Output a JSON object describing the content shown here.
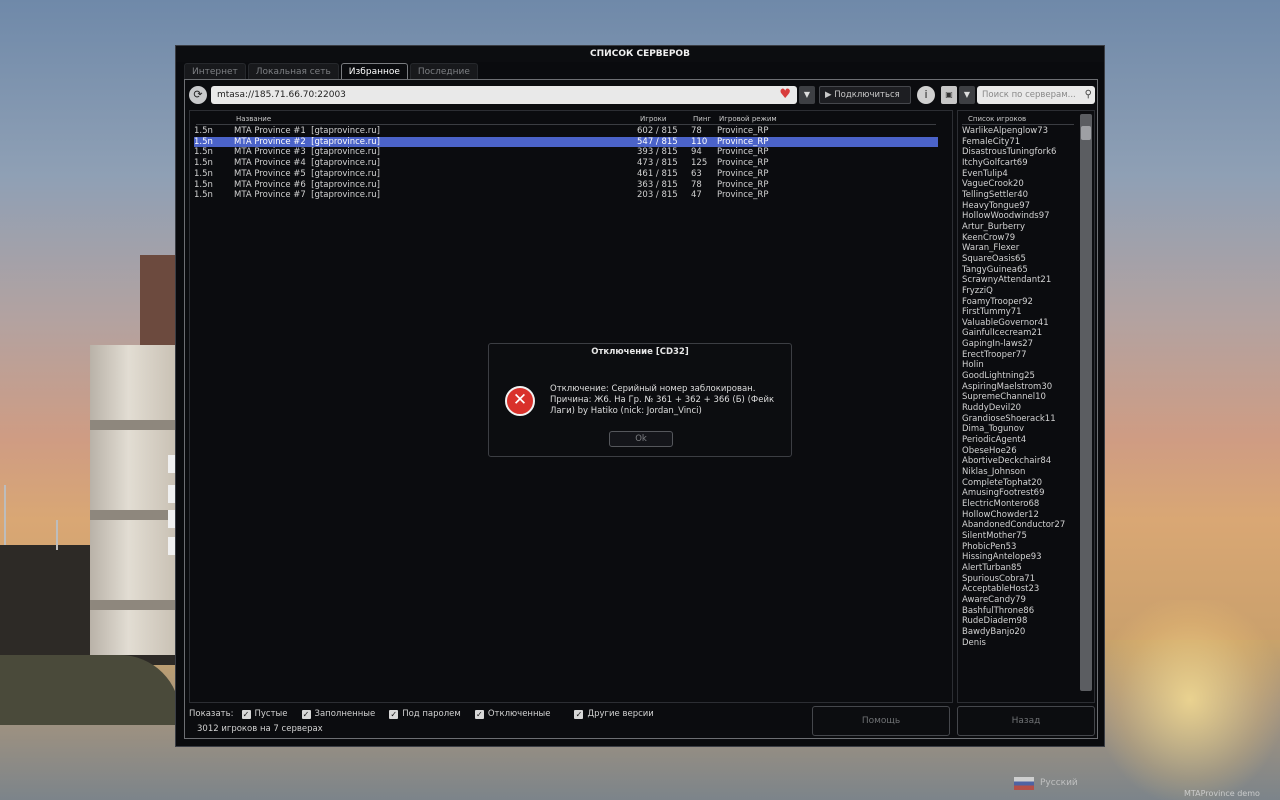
{
  "window": {
    "title": "СПИСОК СЕРВЕРОВ"
  },
  "tabs": [
    {
      "label": "Интернет",
      "active": false
    },
    {
      "label": "Локальная сеть",
      "active": false
    },
    {
      "label": "Избранное",
      "active": true
    },
    {
      "label": "Последние",
      "active": false
    }
  ],
  "toolbar": {
    "address": "mtasa://185.71.66.70:22003",
    "connect_label": "Подключиться",
    "search_placeholder": "Поиск по серверам..."
  },
  "server_list": {
    "columns": {
      "name": "Название",
      "players": "Игроки",
      "ping": "Пинг",
      "gamemode": "Игровой режим"
    },
    "rows": [
      {
        "version": "1.5n",
        "name": "MTA Province #1  [gtaprovince.ru]",
        "players": "602 / 815",
        "ping": "78",
        "gamemode": "Province_RP",
        "selected": false
      },
      {
        "version": "1.5n",
        "name": "MTA Province #2  [gtaprovince.ru]",
        "players": "547 / 815",
        "ping": "110",
        "gamemode": "Province_RP",
        "selected": true
      },
      {
        "version": "1.5n",
        "name": "MTA Province #3  [gtaprovince.ru]",
        "players": "393 / 815",
        "ping": "94",
        "gamemode": "Province_RP",
        "selected": false
      },
      {
        "version": "1.5n",
        "name": "MTA Province #4  [gtaprovince.ru]",
        "players": "473 / 815",
        "ping": "125",
        "gamemode": "Province_RP",
        "selected": false
      },
      {
        "version": "1.5n",
        "name": "MTA Province #5  [gtaprovince.ru]",
        "players": "461 / 815",
        "ping": "63",
        "gamemode": "Province_RP",
        "selected": false
      },
      {
        "version": "1.5n",
        "name": "MTA Province #6  [gtaprovince.ru]",
        "players": "363 / 815",
        "ping": "78",
        "gamemode": "Province_RP",
        "selected": false
      },
      {
        "version": "1.5n",
        "name": "MTA Province #7  [gtaprovince.ru]",
        "players": "203 / 815",
        "ping": "47",
        "gamemode": "Province_RP",
        "selected": false
      }
    ]
  },
  "players_panel": {
    "header": "Список игроков",
    "players": [
      "WarlikeAlpenglow73",
      "FemaleCity71",
      "DisastrousTuningfork6",
      "ItchyGolfcart69",
      "EvenTulip4",
      "VagueCrook20",
      "TellingSettler40",
      "HeavyTongue97",
      "HollowWoodwinds97",
      "Artur_Burberry",
      "KeenCrow79",
      "Waran_Flexer",
      "SquareOasis65",
      "TangyGuinea65",
      "ScrawnyAttendant21",
      "FryzziQ",
      "FoamyTrooper92",
      "FirstTummy71",
      "ValuableGovernor41",
      "GainfulIcecream21",
      "GapingIn-laws27",
      "ErectTrooper77",
      "Holin",
      "GoodLightning25",
      "AspiringMaelstrom30",
      "SupremeChannel10",
      "RuddyDevil20",
      "GrandioseShoerack11",
      "Dima_Togunov",
      "PeriodicAgent4",
      "ObeseHoe26",
      "AbortiveDeckchair84",
      "Niklas_Johnson",
      "CompleteTophat20",
      "AmusingFootrest69",
      "ElectricMontero68",
      "HollowChowder12",
      "AbandonedConductor27",
      "SilentMother75",
      "PhobicPen53",
      "HissingAntelope93",
      "AlertTurban85",
      "SpuriousCobra71",
      "AcceptableHost23",
      "AwareCandy79",
      "BashfulThrone86",
      "RudeDiadem98",
      "BawdyBanjo20",
      "Denis"
    ]
  },
  "filters": {
    "label": "Показать:",
    "options": [
      {
        "label": "Пустые",
        "checked": true
      },
      {
        "label": "Заполненные",
        "checked": true
      },
      {
        "label": "Под паролем",
        "checked": true
      },
      {
        "label": "Отключенные",
        "checked": true
      },
      {
        "label": "Другие версии",
        "checked": true
      }
    ]
  },
  "status_text": "3012 игроков на 7 серверах",
  "buttons": {
    "help": "Помощь",
    "back": "Назад"
  },
  "dialog": {
    "title": "Отключение [CD32]",
    "message_line1": "Отключение: Серийный номер заблокирован.",
    "message_line2": "Причина: Ж6. На Гр. № 361 + 362 + 366 (Б) (Фейк",
    "message_line3": "Лаги) by Hatiko (nick: Jordan_Vinci)",
    "ok_label": "Ok"
  },
  "footer": {
    "language": "Русский",
    "watermark": "MTAProvince demo"
  },
  "colors": {
    "selection": "#4b63c9",
    "error_icon": "#d9312b",
    "heart": "#d83d3d"
  }
}
